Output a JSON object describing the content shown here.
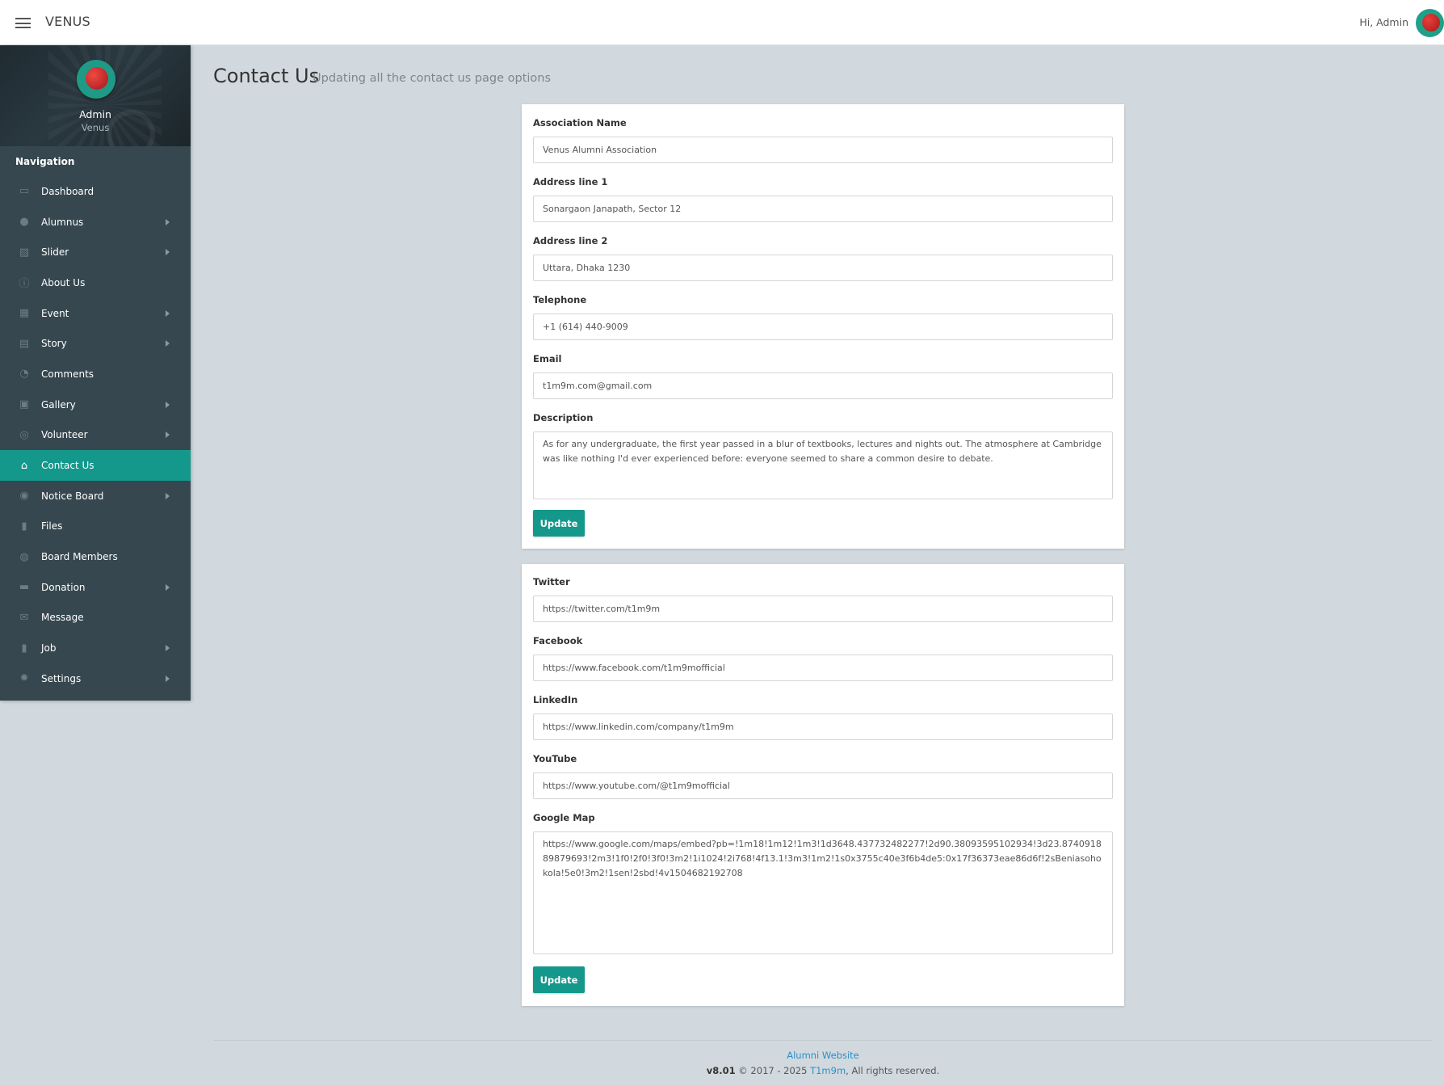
{
  "topbar": {
    "brand": "VENUS",
    "greeting": "Hi, Admin"
  },
  "profile": {
    "name": "Admin",
    "role": "Venus"
  },
  "nav": {
    "heading": "Navigation",
    "items": [
      {
        "label": "Dashboard",
        "icon": "monitor-icon",
        "glyph": "▭",
        "has_arrow": false,
        "active": false
      },
      {
        "label": "Alumnus",
        "icon": "user-icon",
        "glyph": "●",
        "has_arrow": true,
        "active": false
      },
      {
        "label": "Slider",
        "icon": "image-icon",
        "glyph": "▨",
        "has_arrow": true,
        "active": false
      },
      {
        "label": "About Us",
        "icon": "info-icon",
        "glyph": "ⓘ",
        "has_arrow": false,
        "active": false
      },
      {
        "label": "Event",
        "icon": "calendar-icon",
        "glyph": "▦",
        "has_arrow": true,
        "active": false
      },
      {
        "label": "Story",
        "icon": "book-icon",
        "glyph": "▤",
        "has_arrow": true,
        "active": false
      },
      {
        "label": "Comments",
        "icon": "comments-icon",
        "glyph": "◔",
        "has_arrow": false,
        "active": false
      },
      {
        "label": "Gallery",
        "icon": "gallery-icon",
        "glyph": "▣",
        "has_arrow": true,
        "active": false
      },
      {
        "label": "Volunteer",
        "icon": "lifering-icon",
        "glyph": "◎",
        "has_arrow": true,
        "active": false
      },
      {
        "label": "Contact Us",
        "icon": "bank-icon",
        "glyph": "⌂",
        "has_arrow": false,
        "active": true
      },
      {
        "label": "Notice Board",
        "icon": "broadcast-icon",
        "glyph": "◉",
        "has_arrow": true,
        "active": false
      },
      {
        "label": "Files",
        "icon": "file-icon",
        "glyph": "▮",
        "has_arrow": false,
        "active": false
      },
      {
        "label": "Board Members",
        "icon": "user-circle-icon",
        "glyph": "◍",
        "has_arrow": false,
        "active": false
      },
      {
        "label": "Donation",
        "icon": "credit-card-icon",
        "glyph": "▬",
        "has_arrow": true,
        "active": false
      },
      {
        "label": "Message",
        "icon": "envelope-icon",
        "glyph": "✉",
        "has_arrow": false,
        "active": false
      },
      {
        "label": "Job",
        "icon": "lock-icon",
        "glyph": "▮",
        "has_arrow": true,
        "active": false
      },
      {
        "label": "Settings",
        "icon": "gear-icon",
        "glyph": "✹",
        "has_arrow": true,
        "active": false
      }
    ]
  },
  "page": {
    "title": "Contact Us",
    "subtitle": "Updating all the contact us page options"
  },
  "contact_form": {
    "association_name": {
      "label": "Association Name",
      "value": "Venus Alumni Association"
    },
    "address1": {
      "label": "Address line 1",
      "value": "Sonargaon Janapath, Sector 12"
    },
    "address2": {
      "label": "Address line 2",
      "value": "Uttara, Dhaka 1230"
    },
    "telephone": {
      "label": "Telephone",
      "value": "+1 (614) 440-9009"
    },
    "email": {
      "label": "Email",
      "value": "t1m9m.com@gmail.com"
    },
    "description": {
      "label": "Description",
      "value": "As for any undergraduate, the first year passed in a blur of textbooks, lectures and nights out. The atmosphere at Cambridge was like nothing I'd ever experienced before: everyone seemed to share a common desire to debate."
    },
    "submit_label": "Update"
  },
  "social_form": {
    "twitter": {
      "label": "Twitter",
      "value": "https://twitter.com/t1m9m"
    },
    "facebook": {
      "label": "Facebook",
      "value": "https://www.facebook.com/t1m9mofficial"
    },
    "linkedin": {
      "label": "LinkedIn",
      "value": "https://www.linkedin.com/company/t1m9m"
    },
    "youtube": {
      "label": "YouTube",
      "value": "https://www.youtube.com/@t1m9mofficial"
    },
    "google_map": {
      "label": "Google Map",
      "value": "https://www.google.com/maps/embed?pb=!1m18!1m12!1m3!1d3648.437732482277!2d90.38093595102934!3d23.874091889879693!2m3!1f0!2f0!3f0!3m2!1i1024!2i768!4f13.1!3m3!1m2!1s0x3755c40e3f6b4de5:0x17f36373eae86d6f!2sBeniasohokola!5e0!3m2!1sen!2sbd!4v1504682192708"
    },
    "submit_label": "Update"
  },
  "footer": {
    "link": "Alumni Website",
    "version": "v8.01",
    "copy_mid": "© 2017 - 2025",
    "brand": "T1m9m",
    "rights": ", All rights reserved."
  },
  "colors": {
    "accent": "#14988b",
    "sidebar": "#36474f",
    "page_bg": "#d1d9de",
    "link": "#2d8ec9"
  }
}
